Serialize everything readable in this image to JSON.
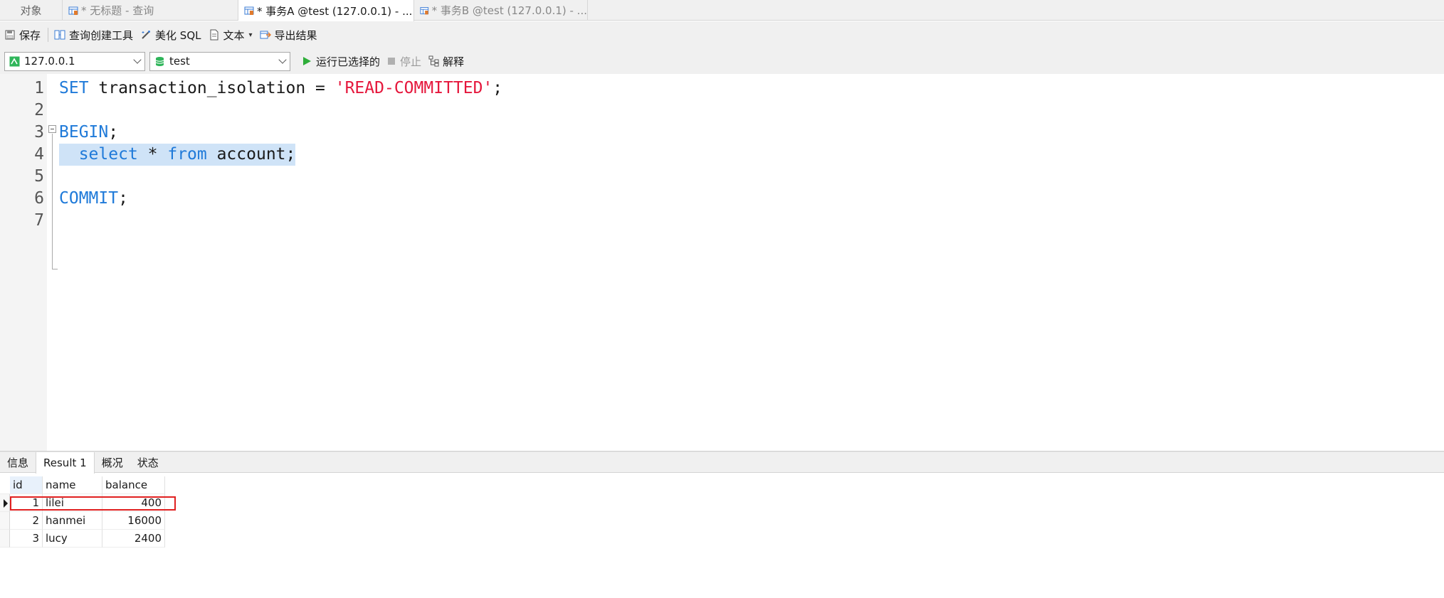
{
  "tabs": {
    "objects": "对象",
    "untitled": "* 无标题 - 查询",
    "tab_a": "* 事务A @test (127.0.0.1) - ...",
    "tab_b": "* 事务B @test (127.0.0.1) - ..."
  },
  "toolbar": {
    "save": "保存",
    "query_builder": "查询创建工具",
    "beautify": "美化 SQL",
    "text": "文本",
    "export": "导出结果"
  },
  "connection": {
    "host": "127.0.0.1",
    "database": "test",
    "run_selected": "运行已选择的",
    "stop": "停止",
    "explain": "解释"
  },
  "editor": {
    "lines": [
      {
        "n": "1",
        "tokens": [
          {
            "t": "SET",
            "c": "kw"
          },
          {
            "t": " transaction_isolation = ",
            "c": "plain"
          },
          {
            "t": "'READ-COMMITTED'",
            "c": "str"
          },
          {
            "t": ";",
            "c": "plain"
          }
        ]
      },
      {
        "n": "2",
        "tokens": []
      },
      {
        "n": "3",
        "tokens": [
          {
            "t": "BEGIN",
            "c": "kw"
          },
          {
            "t": ";",
            "c": "plain"
          }
        ]
      },
      {
        "n": "4",
        "tokens": [
          {
            "t": "  ",
            "c": "plain"
          },
          {
            "t": "select",
            "c": "kw"
          },
          {
            "t": " * ",
            "c": "plain"
          },
          {
            "t": "from",
            "c": "kw"
          },
          {
            "t": " account;",
            "c": "plain"
          }
        ],
        "selected": true
      },
      {
        "n": "5",
        "tokens": []
      },
      {
        "n": "6",
        "tokens": [
          {
            "t": "COMMIT",
            "c": "kw"
          },
          {
            "t": ";",
            "c": "plain"
          }
        ]
      },
      {
        "n": "7",
        "tokens": []
      }
    ]
  },
  "result_tabs": [
    "信息",
    "Result 1",
    "概况",
    "状态"
  ],
  "grid": {
    "columns": [
      "id",
      "name",
      "balance"
    ],
    "rows": [
      [
        "1",
        "lilei",
        "400"
      ],
      [
        "2",
        "hanmei",
        "16000"
      ],
      [
        "3",
        "lucy",
        "2400"
      ]
    ]
  },
  "colors": {
    "keyword": "#1f7ad9",
    "string": "#e5173c",
    "selection": "#cfe3f7",
    "highlight_border": "#e02020"
  }
}
